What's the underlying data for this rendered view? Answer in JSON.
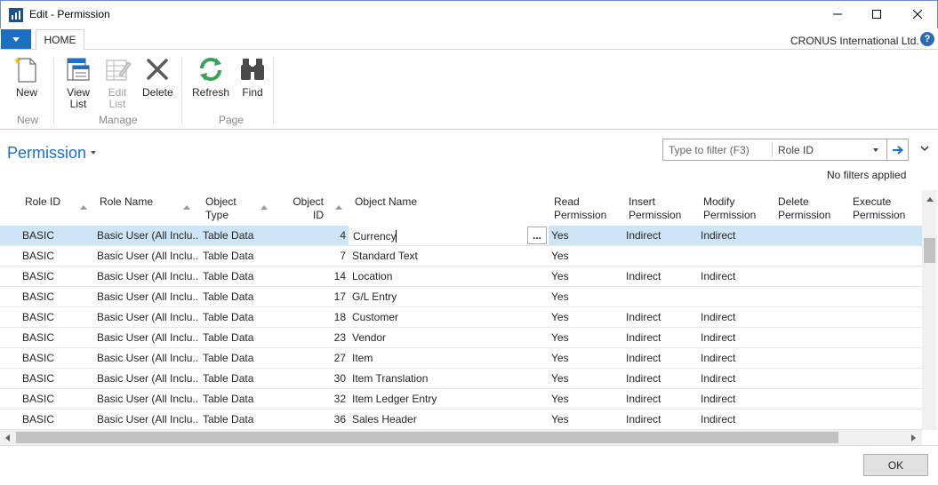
{
  "window": {
    "title": "Edit - Permission",
    "minimize_icon": "minimize-icon",
    "maximize_icon": "maximize-icon",
    "close_icon": "close-icon"
  },
  "ribbon": {
    "tab": "HOME",
    "company": "CRONUS International Ltd.",
    "help": "?",
    "buttons": {
      "new": "New",
      "view_list": "View\nList",
      "edit_list": "Edit\nList",
      "delete": "Delete",
      "refresh": "Refresh",
      "find": "Find"
    },
    "groups": {
      "new": "New",
      "manage": "Manage",
      "page": "Page"
    }
  },
  "page": {
    "title": "Permission",
    "filter_placeholder": "Type to filter (F3)",
    "filter_field": "Role ID",
    "no_filters": "No filters applied"
  },
  "grid": {
    "columns": {
      "role_id": "Role ID",
      "role_name": "Role Name",
      "object_type": "Object\nType",
      "object_id": "Object\nID",
      "object_name": "Object Name",
      "read": "Read\nPermission",
      "insert": "Insert\nPermission",
      "modify": "Modify\nPermission",
      "delete": "Delete\nPermission",
      "execute": "Execute\nPermission"
    },
    "rows": [
      {
        "role_id": "BASIC",
        "role_name": "Basic User (All Inclu...",
        "object_type": "Table Data",
        "object_id": "4",
        "object_name": "Currency",
        "read": "Yes",
        "insert": "Indirect",
        "modify": "Indirect",
        "delete": "",
        "execute": ""
      },
      {
        "role_id": "BASIC",
        "role_name": "Basic User (All Inclu...",
        "object_type": "Table Data",
        "object_id": "7",
        "object_name": "Standard Text",
        "read": "Yes",
        "insert": "",
        "modify": "",
        "delete": "",
        "execute": ""
      },
      {
        "role_id": "BASIC",
        "role_name": "Basic User (All Inclu...",
        "object_type": "Table Data",
        "object_id": "14",
        "object_name": "Location",
        "read": "Yes",
        "insert": "Indirect",
        "modify": "Indirect",
        "delete": "",
        "execute": ""
      },
      {
        "role_id": "BASIC",
        "role_name": "Basic User (All Inclu...",
        "object_type": "Table Data",
        "object_id": "17",
        "object_name": "G/L Entry",
        "read": "Yes",
        "insert": "",
        "modify": "",
        "delete": "",
        "execute": ""
      },
      {
        "role_id": "BASIC",
        "role_name": "Basic User (All Inclu...",
        "object_type": "Table Data",
        "object_id": "18",
        "object_name": "Customer",
        "read": "Yes",
        "insert": "Indirect",
        "modify": "Indirect",
        "delete": "",
        "execute": ""
      },
      {
        "role_id": "BASIC",
        "role_name": "Basic User (All Inclu...",
        "object_type": "Table Data",
        "object_id": "23",
        "object_name": "Vendor",
        "read": "Yes",
        "insert": "Indirect",
        "modify": "Indirect",
        "delete": "",
        "execute": ""
      },
      {
        "role_id": "BASIC",
        "role_name": "Basic User (All Inclu...",
        "object_type": "Table Data",
        "object_id": "27",
        "object_name": "Item",
        "read": "Yes",
        "insert": "Indirect",
        "modify": "Indirect",
        "delete": "",
        "execute": ""
      },
      {
        "role_id": "BASIC",
        "role_name": "Basic User (All Inclu...",
        "object_type": "Table Data",
        "object_id": "30",
        "object_name": "Item Translation",
        "read": "Yes",
        "insert": "Indirect",
        "modify": "Indirect",
        "delete": "",
        "execute": ""
      },
      {
        "role_id": "BASIC",
        "role_name": "Basic User (All Inclu...",
        "object_type": "Table Data",
        "object_id": "32",
        "object_name": "Item Ledger Entry",
        "read": "Yes",
        "insert": "Indirect",
        "modify": "Indirect",
        "delete": "",
        "execute": ""
      },
      {
        "role_id": "BASIC",
        "role_name": "Basic User (All Inclu...",
        "object_type": "Table Data",
        "object_id": "36",
        "object_name": "Sales Header",
        "read": "Yes",
        "insert": "Indirect",
        "modify": "Indirect",
        "delete": "",
        "execute": ""
      }
    ],
    "assist_button": "..."
  },
  "footer": {
    "ok": "OK"
  },
  "colors": {
    "accent": "#1e6fc3",
    "selected_row": "#cde5f7"
  }
}
